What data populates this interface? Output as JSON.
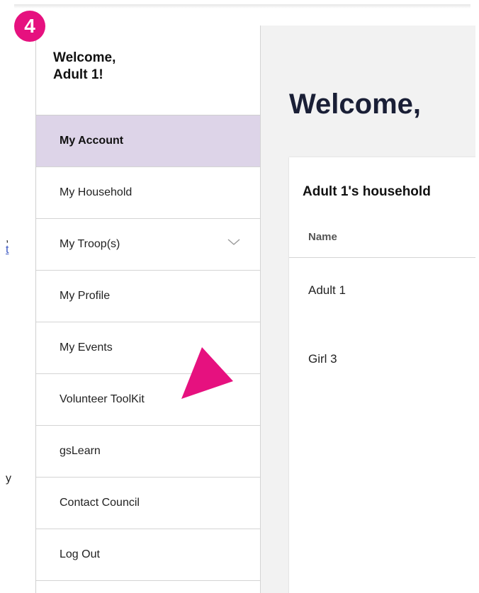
{
  "badge": {
    "number": "4"
  },
  "left_fragments": [
    ",",
    "t",
    "y"
  ],
  "sidebar": {
    "welcome_line1": "Welcome,",
    "welcome_line2": "Adult 1!",
    "items": [
      {
        "label": "My Account"
      },
      {
        "label": "My Household"
      },
      {
        "label": "My Troop(s)"
      },
      {
        "label": "My Profile"
      },
      {
        "label": "My Events"
      },
      {
        "label": "Volunteer ToolKit"
      },
      {
        "label": "gsLearn"
      },
      {
        "label": "Contact Council"
      },
      {
        "label": "Log Out"
      }
    ]
  },
  "main": {
    "title": "Welcome,",
    "household": {
      "title": "Adult 1's household",
      "column_name": "Name",
      "rows": [
        "Adult 1",
        "Girl 3"
      ]
    }
  },
  "colors": {
    "badge": "#e6117f",
    "active_nav": "#ddd4e8",
    "pointer": "#e6117f",
    "link": "#3b57c2"
  }
}
